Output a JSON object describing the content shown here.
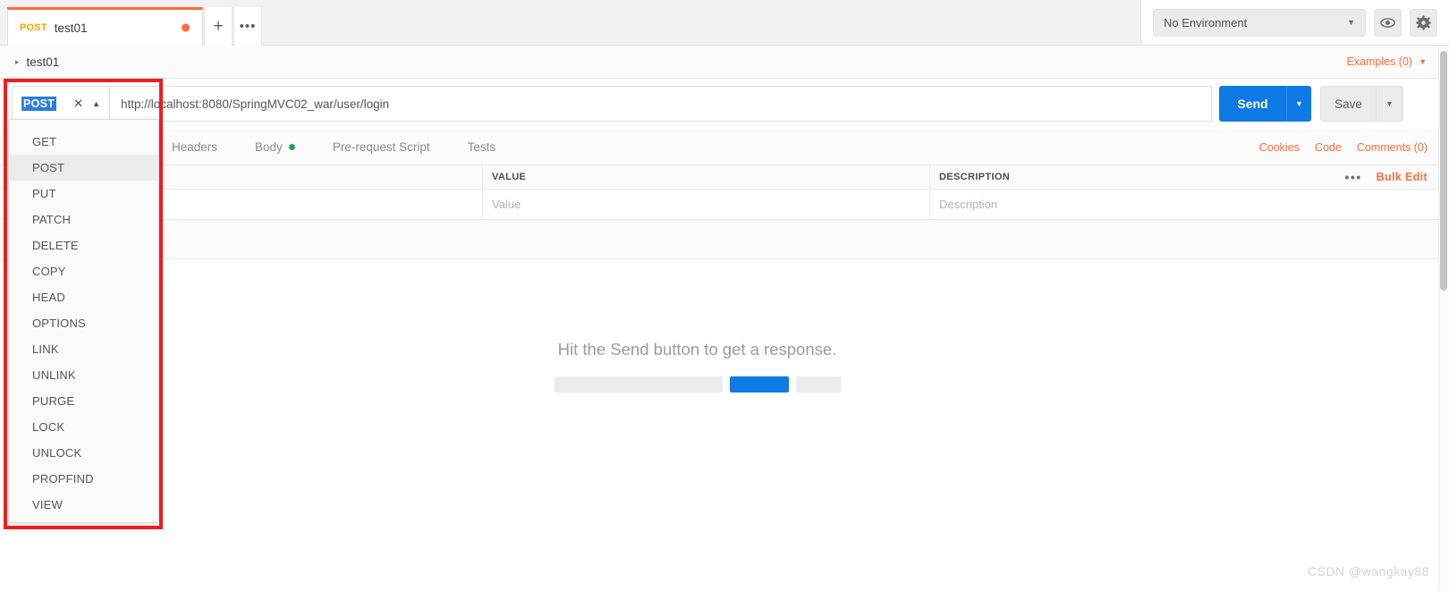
{
  "tabbar": {
    "tab": {
      "method": "POST",
      "name": "test01",
      "unsaved_dot": "●"
    },
    "new_tab_label": "+",
    "more_label": "•••"
  },
  "topright": {
    "environment": "No Environment",
    "caret": "▼",
    "eye_icon": "eye-icon",
    "gear_icon": "gear-icon"
  },
  "breadcrumb": {
    "triangle": "▸",
    "label": "test01",
    "examples": "Examples (0)",
    "examples_caret": "▼"
  },
  "urlbar": {
    "method": "POST",
    "clear_icon": "✕",
    "collapse_caret": "▲",
    "url": "http://localhost:8080/SpringMVC02_war/user/login",
    "send_label": "Send",
    "send_caret": "▼",
    "save_label": "Save",
    "save_caret": "▼"
  },
  "request_tabs": {
    "items": [
      {
        "label": "Headers",
        "dot": false
      },
      {
        "label": "Body",
        "dot": true
      },
      {
        "label": "Pre-request Script",
        "dot": false
      },
      {
        "label": "Tests",
        "dot": false
      }
    ],
    "links": [
      "Cookies",
      "Code",
      "Comments (0)"
    ]
  },
  "param_table": {
    "headers": [
      "",
      "VALUE",
      "DESCRIPTION"
    ],
    "row": {
      "key": "",
      "value": "Value",
      "description": "Description"
    },
    "actions": {
      "dots": "•••",
      "bulk_edit": "Bulk Edit"
    }
  },
  "response": {
    "message": "Hit the Send button to get a response.",
    "accent_color": "#0d7ae5"
  },
  "method_dropdown": {
    "selected": "POST",
    "items": [
      "GET",
      "POST",
      "PUT",
      "PATCH",
      "DELETE",
      "COPY",
      "HEAD",
      "OPTIONS",
      "LINK",
      "UNLINK",
      "PURGE",
      "LOCK",
      "UNLOCK",
      "PROPFIND",
      "VIEW"
    ],
    "highlight_color": "#ef1c1c"
  },
  "watermark": "CSDN @wangkay88"
}
